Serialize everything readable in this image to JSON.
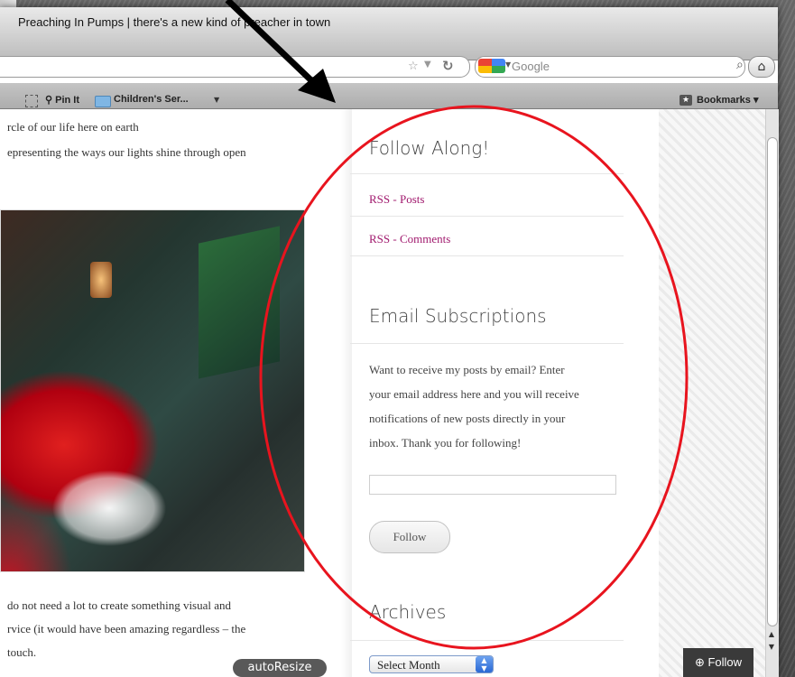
{
  "window": {
    "title": "Preaching In Pumps | there's a new kind of preacher in town"
  },
  "toolbar": {
    "search_placeholder": "Google",
    "star_icon": "star-icon",
    "reload_icon": "reload-icon",
    "home_icon": "home-icon",
    "magnifier_icon": "magnifier-icon"
  },
  "bookmarks_bar": {
    "items": [
      {
        "label": "Pin It",
        "icon": "pin-icon"
      },
      {
        "label": "Children's Ser...",
        "icon": "folder-icon"
      }
    ],
    "bookmarks_menu": "Bookmarks"
  },
  "post": {
    "lines_top": [
      "rcle of our life here on earth",
      "epresenting the ways our lights shine through open"
    ],
    "lines_bottom": [
      "do not need a lot to create something visual and",
      "rvice (it would have been amazing regardless – the",
      "touch."
    ]
  },
  "sidebar": {
    "follow": {
      "title": "Follow Along!",
      "links": [
        "RSS - Posts",
        "RSS - Comments"
      ]
    },
    "email": {
      "title": "Email Subscriptions",
      "description_lines": [
        "Want to receive my posts by email? Enter",
        "your email address here and you will receive",
        "notifications of new posts directly in your",
        "inbox. Thank you for following!"
      ],
      "input_value": "",
      "button_label": "Follow"
    },
    "archives": {
      "title": "Archives",
      "select_value": "Select Month"
    }
  },
  "overlays": {
    "autoresize_label": "autoResize",
    "follow_badge_label": "Follow"
  },
  "annotation": {
    "circle_color": "#e8141e",
    "arrow_color": "#000000"
  }
}
